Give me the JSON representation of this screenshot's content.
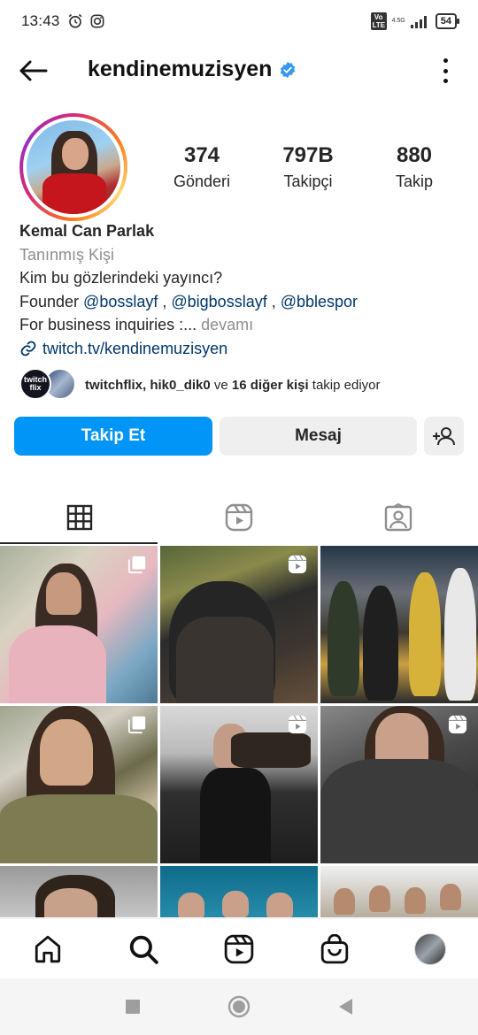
{
  "status_bar": {
    "time": "13:43",
    "volte": "Vo LTE",
    "network": "4.5G",
    "battery": "54"
  },
  "header": {
    "username": "kendinemuzisyen"
  },
  "profile": {
    "stats": [
      {
        "value": "374",
        "label": "Gönderi"
      },
      {
        "value": "797B",
        "label": "Takipçi"
      },
      {
        "value": "880",
        "label": "Takip"
      }
    ],
    "full_name": "Kemal Can Parlak",
    "category": "Tanınmış Kişi",
    "bio_line1": "Kim bu gözlerindeki yayıncı?",
    "bio_founder_prefix": "Founder ",
    "mentions": [
      "@bosslayf",
      "@bigbosslayf",
      "@bblespor"
    ],
    "bio_business": "For business inquiries :...",
    "more_label": "devamı",
    "link": "twitch.tv/kendinemuzisyen"
  },
  "followed_by": {
    "avatar1_text": "twitch flix",
    "names": "twitchflix, hik0_dik0",
    "joiner": " ve ",
    "others": "16 diğer kişi",
    "suffix": " takip ediyor"
  },
  "buttons": {
    "follow": "Takip Et",
    "message": "Mesaj"
  },
  "tabs": [
    "grid-icon",
    "reels-icon",
    "tagged-icon"
  ],
  "posts": [
    {
      "badge": "carousel-icon"
    },
    {
      "badge": "reel-icon"
    },
    {
      "badge": ""
    },
    {
      "badge": "carousel-icon"
    },
    {
      "badge": "reel-icon"
    },
    {
      "badge": "reel-icon"
    },
    {
      "badge": ""
    },
    {
      "badge": ""
    },
    {
      "badge": ""
    }
  ],
  "bottom_nav": [
    "home-icon",
    "search-icon",
    "reels-icon",
    "shop-icon",
    "profile-avatar"
  ],
  "colors": {
    "accent": "#0095f6",
    "link": "#00376b",
    "muted": "#8e8e8e",
    "verified": "#3897f0"
  }
}
